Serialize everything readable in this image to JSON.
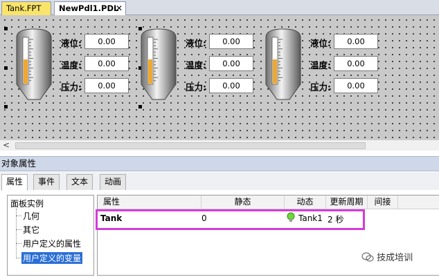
{
  "doc_tabs": [
    {
      "label": "Tank.FPT"
    },
    {
      "label": "NewPdl1.PDL",
      "close": "✕"
    }
  ],
  "canvas": {
    "tanks": [
      {
        "level_fraction": 0.55,
        "fields": [
          {
            "label": "液位:",
            "value": "0.00"
          },
          {
            "label": "温度:",
            "value": "0.00"
          },
          {
            "label": "压力:",
            "value": "0.00"
          }
        ]
      },
      {
        "level_fraction": 0.55,
        "fields": [
          {
            "label": "液位:",
            "value": "0.00"
          },
          {
            "label": "温度:",
            "value": "0.00"
          },
          {
            "label": "压力:",
            "value": "0.00"
          }
        ]
      },
      {
        "level_fraction": 0.55,
        "fields": [
          {
            "label": "液位:",
            "value": "0.00"
          },
          {
            "label": "温度:",
            "value": "0.00"
          },
          {
            "label": "压力:",
            "value": "0.00"
          }
        ]
      }
    ]
  },
  "scrollbar": {
    "left_arrow": "<"
  },
  "properties": {
    "title": "对象属性",
    "tabs": [
      "属性",
      "事件",
      "文本",
      "动画"
    ],
    "tree": {
      "root": "面板实例",
      "children": [
        "几何",
        "其它",
        "用户定义的属性",
        "用户定义的变量"
      ],
      "selected_index": 3
    },
    "grid": {
      "headers": [
        "属性",
        "静态",
        "动态",
        "更新周期",
        "间接"
      ],
      "row": {
        "name": "Tank",
        "static": "0",
        "dynamic": "Tank1",
        "update": "2 秒",
        "indirect": ""
      },
      "dynamic_icon": "lightbulb-icon"
    }
  },
  "watermark": {
    "text": "技成培训"
  },
  "colors": {
    "highlight": "#d43ad9",
    "tank_fill": "#f0a830",
    "selection": "#2b6fd6"
  }
}
